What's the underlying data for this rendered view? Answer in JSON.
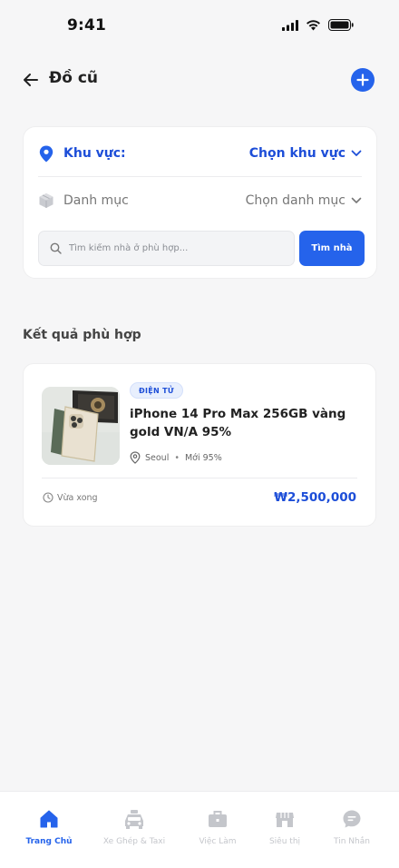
{
  "status_bar": {
    "time": "9:41"
  },
  "header": {
    "title": "Đồ cũ"
  },
  "filters": {
    "region_label": "Khu vực:",
    "region_value": "Chọn khu vực",
    "category_label": "Danh mục",
    "category_value": "Chọn danh mục",
    "search_placeholder": "Tìm kiếm nhà ở phù hợp...",
    "search_button": "Tìm nhà"
  },
  "results": {
    "section_title": "Kết quả phù hợp",
    "items": [
      {
        "badge": "ĐIỆN TỬ",
        "title": "iPhone 14 Pro Max 256GB vàng gold VN/A 95%",
        "location": "Seoul",
        "condition": "Mới 95%",
        "time": "Vừa xong",
        "price": "₩2,500,000"
      }
    ]
  },
  "bottom_nav": {
    "items": [
      {
        "label": "Trang Chủ",
        "icon": "home-icon",
        "active": true
      },
      {
        "label": "Xe Ghép & Taxi",
        "icon": "taxi-icon",
        "active": false
      },
      {
        "label": "Việc Làm",
        "icon": "briefcase-icon",
        "active": false
      },
      {
        "label": "Siêu thị",
        "icon": "store-icon",
        "active": false
      },
      {
        "label": "Tin Nhắn",
        "icon": "chat-icon",
        "active": false
      }
    ]
  },
  "colors": {
    "accent": "#2563eb",
    "accent_text": "#1d4ed8",
    "background": "#f6f6f7",
    "inactive_nav": "#c4c6cb"
  }
}
